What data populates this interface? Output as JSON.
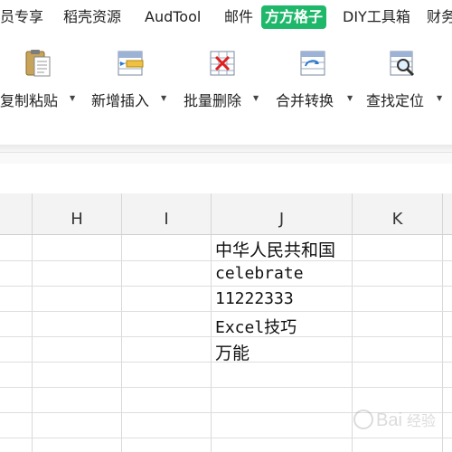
{
  "menu": {
    "tabs": [
      {
        "label": "员专享"
      },
      {
        "label": "稻壳资源"
      },
      {
        "label": "AudTool"
      },
      {
        "label": "邮件"
      },
      {
        "label": "方方格子",
        "active": true
      },
      {
        "label": "DIY工具箱"
      },
      {
        "label": "财务"
      }
    ]
  },
  "ribbon": {
    "tools": [
      {
        "label": "复制粘贴",
        "icon": "clipboard-paste-icon"
      },
      {
        "label": "新增插入",
        "icon": "insert-row-icon"
      },
      {
        "label": "批量删除",
        "icon": "delete-grid-icon"
      },
      {
        "label": "合并转换",
        "icon": "merge-convert-icon"
      },
      {
        "label": "查找定位",
        "icon": "find-locate-icon"
      }
    ]
  },
  "sheet": {
    "columns": [
      "H",
      "I",
      "J",
      "K"
    ],
    "cells": {
      "J1": "中华人民共和国",
      "J2": "celebrate",
      "J3": "11222333",
      "J4": "Excel技巧",
      "J5": "万能"
    }
  },
  "colors": {
    "accent": "#1fb86a",
    "header_bg": "#f3f3f3",
    "grid_line": "#d9d9d9"
  }
}
